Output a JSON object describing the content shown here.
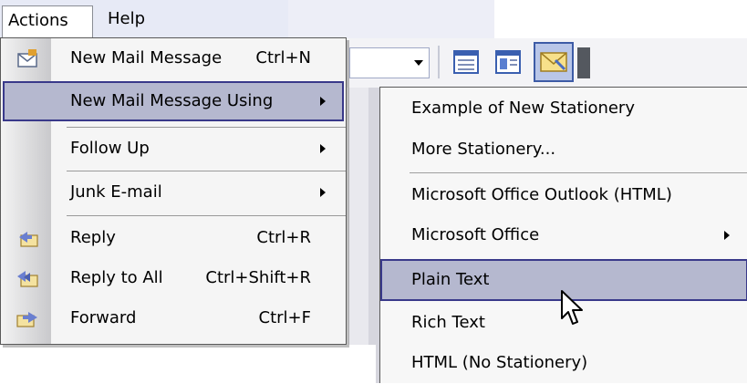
{
  "menubar": {
    "actions": "Actions",
    "help": "Help"
  },
  "actions_menu": {
    "items": [
      {
        "label": "New Mail Message",
        "accel": "Ctrl+N",
        "icon": "new-mail-icon"
      },
      {
        "label": "New Mail Message Using",
        "submenu": true
      },
      {
        "label": "Follow Up",
        "submenu": true
      },
      {
        "label": "Junk E-mail",
        "submenu": true
      },
      {
        "label": "Reply",
        "accel": "Ctrl+R",
        "icon": "reply-icon"
      },
      {
        "label": "Reply to All",
        "accel": "Ctrl+Shift+R",
        "icon": "reply-all-icon"
      },
      {
        "label": "Forward",
        "accel": "Ctrl+F",
        "icon": "forward-icon"
      }
    ]
  },
  "submenu": {
    "items": [
      {
        "label": "Example of New Stationery"
      },
      {
        "label": "More Stationery..."
      },
      {
        "label": "Microsoft Office Outlook (HTML)"
      },
      {
        "label": "Microsoft Office",
        "submenu": true
      },
      {
        "label": "Plain Text"
      },
      {
        "label": "Rich Text"
      },
      {
        "label": "HTML (No Stationery)"
      }
    ]
  },
  "colors": {
    "highlight": "#b5b8cf",
    "highlight_border": "#39398a",
    "menubar": "#e7eaf6"
  }
}
